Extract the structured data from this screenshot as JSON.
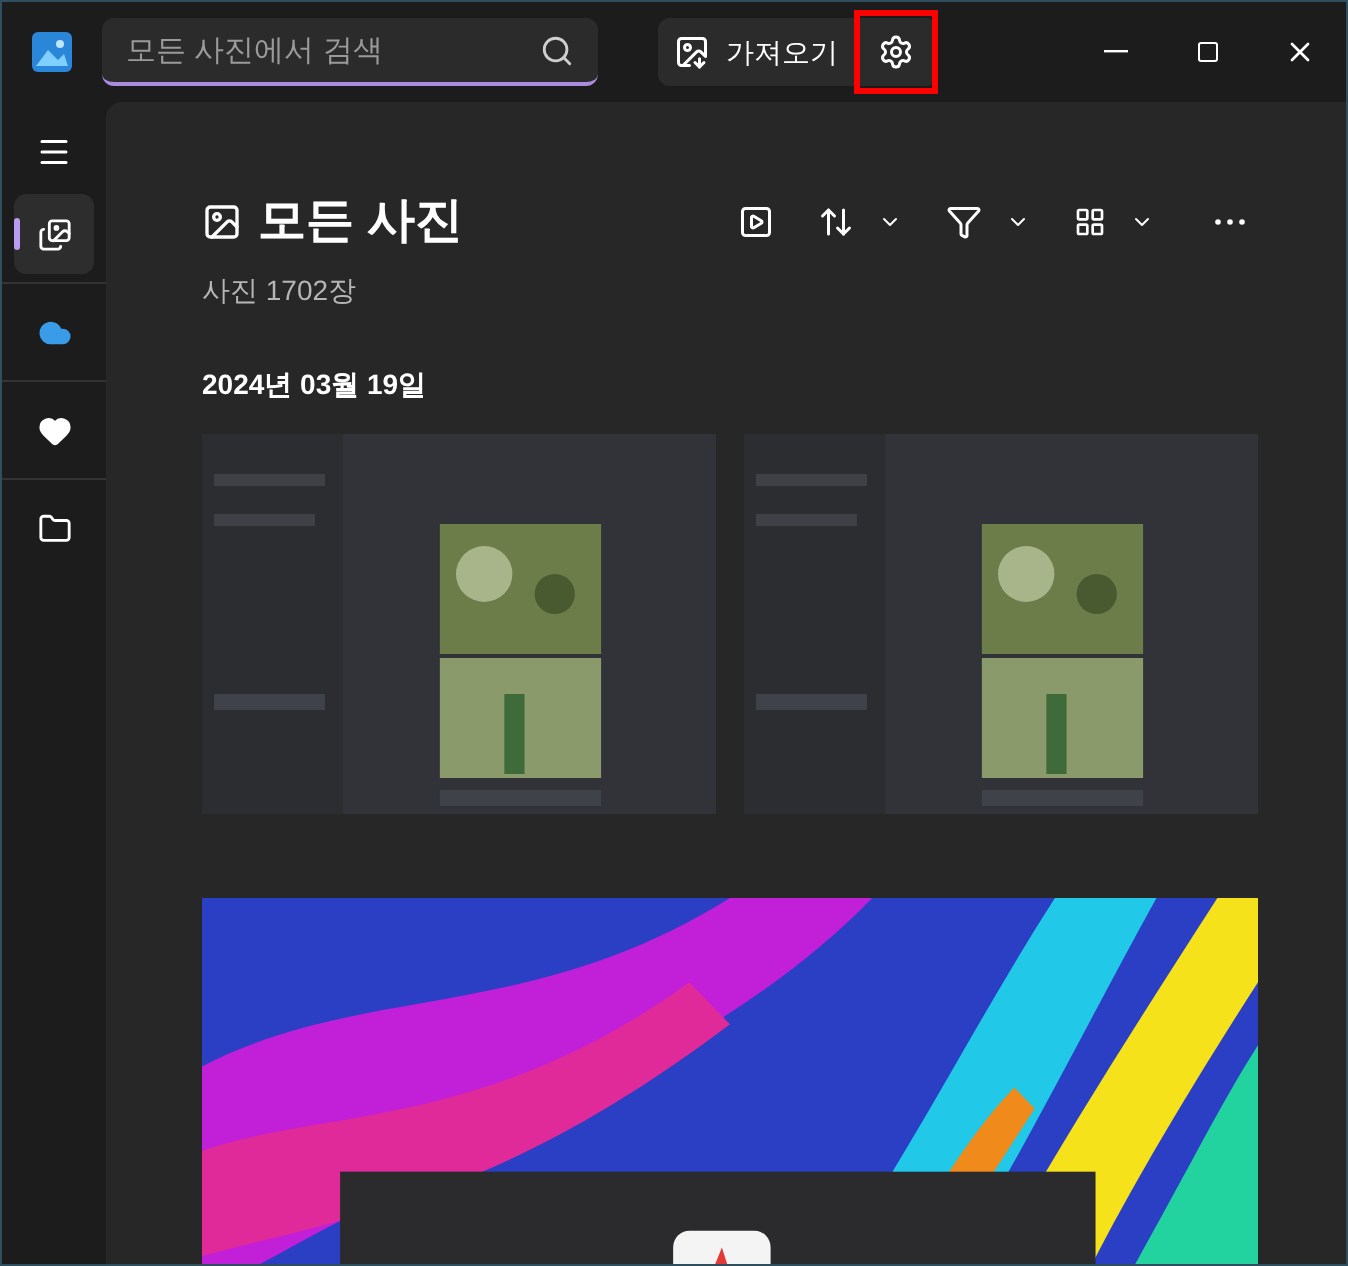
{
  "search": {
    "placeholder": "모든 사진에서 검색"
  },
  "import_button": {
    "label": "가져오기"
  },
  "settings_button": {
    "highlighted": true
  },
  "nav": [
    {
      "kind": "photos",
      "selected": true
    },
    {
      "kind": "cloud",
      "selected": false
    },
    {
      "kind": "favorites",
      "selected": false
    },
    {
      "kind": "folders",
      "selected": false
    }
  ],
  "page": {
    "title": "모든 사진",
    "count": "사진 1702장"
  },
  "groups": [
    {
      "date": "2024년 03월 19일"
    }
  ]
}
